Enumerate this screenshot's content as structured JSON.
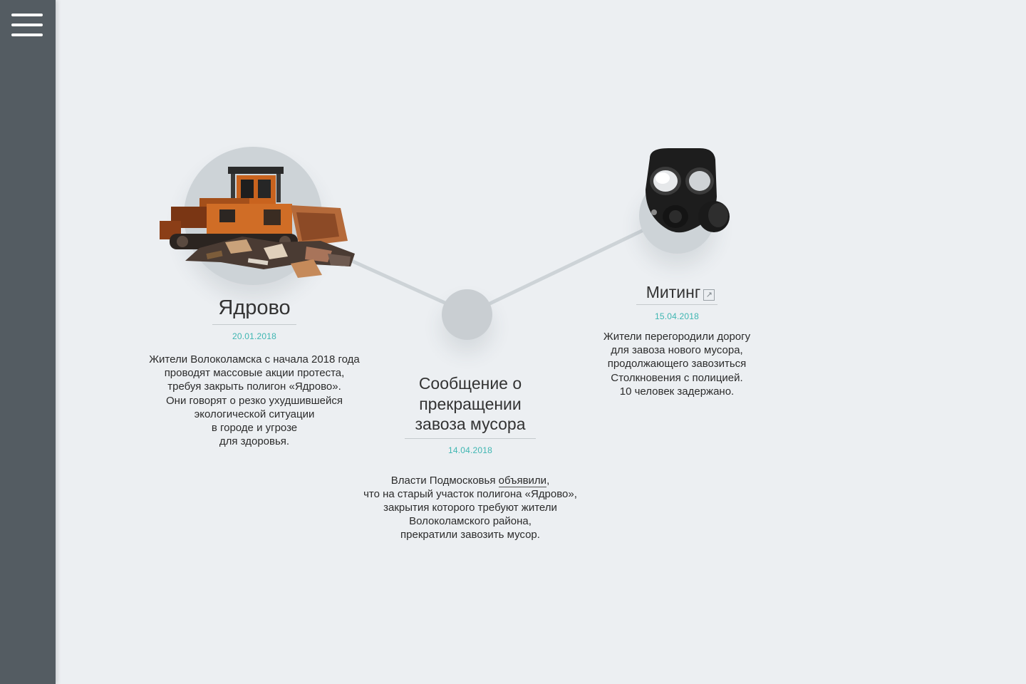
{
  "sidebar": {
    "menu_icon": "hamburger-menu-icon"
  },
  "colors": {
    "accent": "#3fb6b2",
    "sidebar": "#545c62",
    "background": "#eceff2",
    "line": "#cdd3d7"
  },
  "events": [
    {
      "title": "Ядрово",
      "date": "20.01.2018",
      "image": "bulldozer-garbage",
      "lines": [
        "Жители Волоколамска с начала 2018 года",
        "проводят массовые акции протеста,",
        "требуя закрыть полигон «Ядрово».",
        "Они говорят о резко ухудшившейся",
        "экологической ситуации",
        "в городе и угрозе",
        "для здоровья."
      ]
    },
    {
      "title_lines": [
        "Сообщение о",
        "прекращении",
        "завоза мусора"
      ],
      "date": "14.04.2018",
      "line1_before": "Власти Подмосковья ",
      "line1_link": "объявили",
      "line1_after": ",",
      "lines": [
        "что на старый участок полигона «Ядрово»,",
        "закрытия которого требуют жители",
        "Волоколамского района,",
        "прекратили завозить мусор."
      ]
    },
    {
      "title": "Митинг",
      "external_icon": "external-link-icon",
      "date": "15.04.2018",
      "image": "gas-mask",
      "lines": [
        "Жители перегородили дорогу",
        "для завоза нового мусора,",
        "продолжающего завозиться",
        "Столкновения с полицией.",
        "10 человек задержано."
      ]
    }
  ]
}
